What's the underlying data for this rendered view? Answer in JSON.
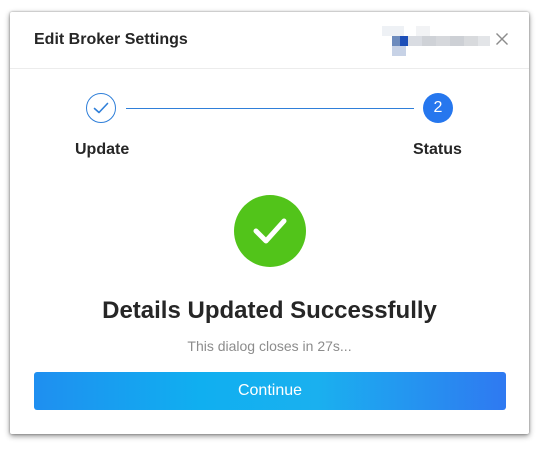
{
  "dialog": {
    "title": "Edit Broker Settings",
    "redacted_label": "",
    "close_icon": "close-icon"
  },
  "stepper": {
    "steps": [
      {
        "label": "Update",
        "state": "complete",
        "icon": "check-icon"
      },
      {
        "label": "Status",
        "state": "active",
        "number": "2"
      }
    ],
    "accent_color": "#2677ee"
  },
  "result": {
    "icon": "check-circle-icon",
    "icon_color": "#52c41a",
    "heading": "Details Updated Successfully",
    "countdown_text": "This dialog closes in 27s..."
  },
  "actions": {
    "continue_label": "Continue"
  }
}
